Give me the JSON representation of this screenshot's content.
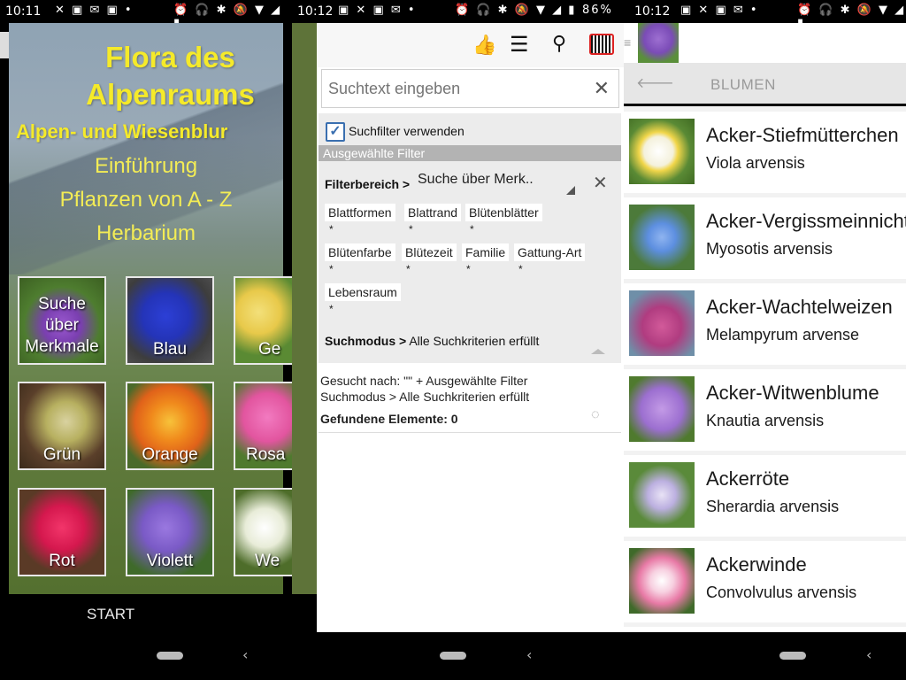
{
  "panel1": {
    "time": "10:11",
    "title_line1": "Flora des",
    "title_line2": "Alpenraums",
    "subtitle": "Alpen- und Wiesenblur",
    "menu": [
      "Einführung",
      "Pflanzen von A - Z",
      "Herbarium"
    ],
    "tiles": [
      {
        "label": "Suche über Merkmale"
      },
      {
        "label": "Blau"
      },
      {
        "label": "Ge"
      },
      {
        "label": "Grün"
      },
      {
        "label": "Orange"
      },
      {
        "label": "Rosa"
      },
      {
        "label": "Rot"
      },
      {
        "label": "Violett"
      },
      {
        "label": "We"
      }
    ],
    "start_label": "START"
  },
  "panel2": {
    "time": "10:12",
    "battery": "86%",
    "search_placeholder": "Suchtext eingeben",
    "filter_checkbox_label": "Suchfilter verwenden",
    "selected_filter_header": "Ausgewählte Filter",
    "filterbereich_label": "Filterbereich >",
    "filterbereich_value": "Suche über Merk..",
    "chips": [
      "Blattformen",
      "Blattrand",
      "Blütenblätter",
      "Blütenfarbe",
      "Blütezeit",
      "Familie",
      "Gattung-Art",
      "Lebensraum"
    ],
    "chip_value": "*",
    "suchmodus_label": "Suchmodus >",
    "suchmodus_value": "Alle Suchkriterien erfüllt",
    "result_line1": "Gesucht nach:  \"\" + Ausgewählte Filter",
    "result_line2": "Suchmodus > Alle Suchkriterien erfüllt",
    "found_label": "Gefundene Elemente: 0"
  },
  "panel3": {
    "time": "10:12",
    "category_title": "BLUMEN",
    "items": [
      {
        "name": "Acker-Stiefmütterchen",
        "latin": "Viola arvensis"
      },
      {
        "name": "Acker-Vergissmeinnicht",
        "latin": "Myosotis arvensis"
      },
      {
        "name": "Acker-Wachtelweizen",
        "latin": "Melampyrum arvense"
      },
      {
        "name": "Acker-Witwenblume",
        "latin": "Knautia arvensis"
      },
      {
        "name": "Ackerröte",
        "latin": "Sherardia arvensis"
      },
      {
        "name": "Ackerwinde",
        "latin": "Convolvulus arvensis"
      }
    ]
  }
}
